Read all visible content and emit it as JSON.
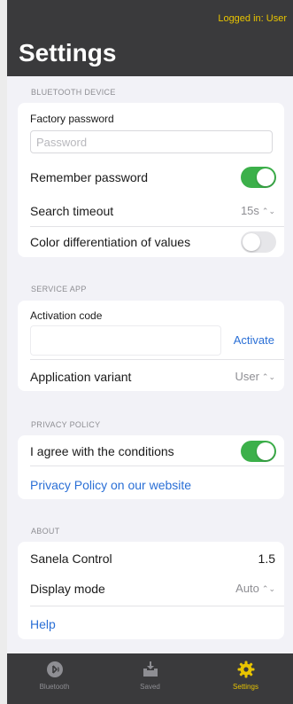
{
  "header": {
    "login_status": "Logged in: User",
    "title": "Settings"
  },
  "sections": {
    "bluetooth": {
      "header": "BLUETOOTH DEVICE",
      "factory_password_label": "Factory password",
      "password_placeholder": "Password",
      "password_value": "",
      "remember_password_label": "Remember password",
      "remember_password_on": true,
      "search_timeout_label": "Search timeout",
      "search_timeout_value": "15s",
      "color_diff_label": "Color differentiation of values",
      "color_diff_on": false
    },
    "service_app": {
      "header": "SERVICE APP",
      "activation_code_label": "Activation code",
      "activation_code_value": "",
      "activate_label": "Activate",
      "app_variant_label": "Application variant",
      "app_variant_value": "User"
    },
    "privacy": {
      "header": "PRIVACY POLICY",
      "agree_label": "I agree with the conditions",
      "agree_on": true,
      "website_link": "Privacy Policy on our website"
    },
    "about": {
      "header": "ABOUT",
      "app_name_label": "Sanela Control",
      "app_version": "1.5",
      "display_mode_label": "Display mode",
      "display_mode_value": "Auto",
      "help_link": "Help"
    }
  },
  "tabbar": {
    "tabs": [
      {
        "label": "Bluetooth",
        "icon": "bluetooth-icon",
        "active": false
      },
      {
        "label": "Saved",
        "icon": "download-tray-icon",
        "active": false
      },
      {
        "label": "Settings",
        "icon": "gear-icon",
        "active": true
      }
    ]
  },
  "colors": {
    "accent_yellow": "#e8c400",
    "toggle_green": "#3cb04a",
    "link_blue": "#2a6fd6",
    "header_bg": "#3a3a3c"
  }
}
